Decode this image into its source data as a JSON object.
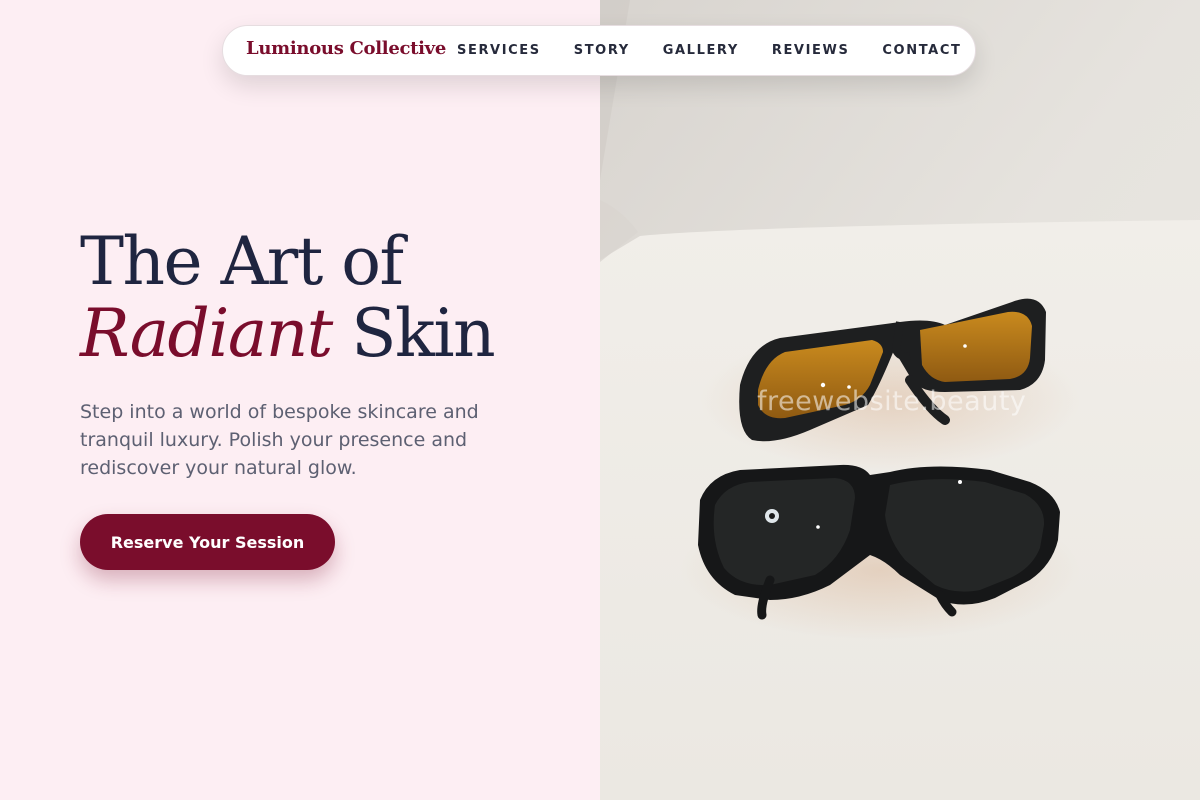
{
  "nav": {
    "brand": "Luminous Collective",
    "links": [
      "SERVICES",
      "STORY",
      "GALLERY",
      "REVIEWS",
      "CONTACT"
    ]
  },
  "hero": {
    "title_line1": "The Art of",
    "title_accent": "Radiant",
    "title_line2_rest": " Skin",
    "subtitle": "Step into a world of bespoke skincare and tranquil luxury. Polish your presence and rediscover your natural glow.",
    "cta_label": "Reserve Your Session"
  },
  "image": {
    "subject": "protective-glasses-icon"
  },
  "watermark": "freewebsite.beauty",
  "colors": {
    "accent": "#7a0d2c",
    "heading": "#1f2540",
    "body_text": "#5d6072",
    "left_background": "#fdeef3",
    "nav_background": "#ffffff"
  }
}
